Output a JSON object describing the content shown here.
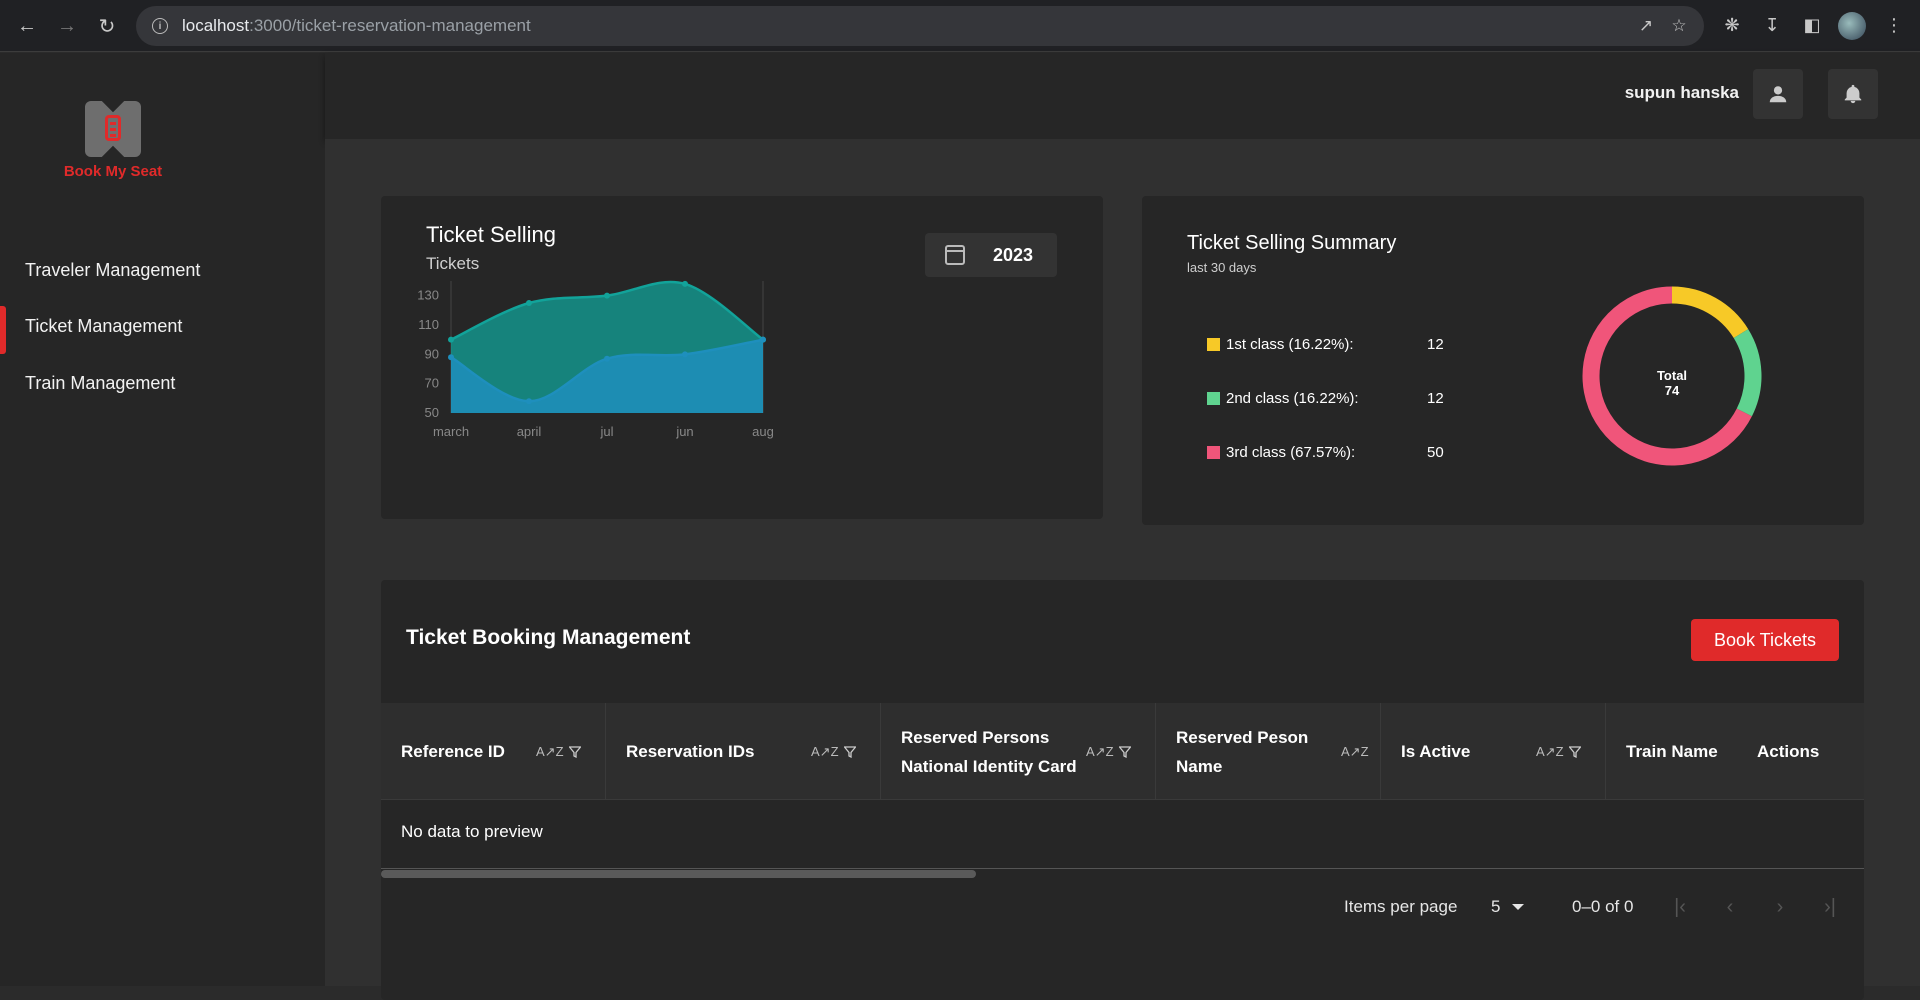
{
  "browser": {
    "url_host": "localhost",
    "url_path": ":3000/ticket-reservation-management"
  },
  "app": {
    "logo_text": "Book My Seat",
    "brand_color": "#e02a2a"
  },
  "sidebar": {
    "items": [
      {
        "label": "Traveler Management",
        "active": false
      },
      {
        "label": "Ticket Management",
        "active": true
      },
      {
        "label": "Train Management",
        "active": false
      }
    ]
  },
  "header": {
    "username": "supun hanska"
  },
  "selling_chart": {
    "title": "Ticket Selling",
    "subtitle": "Tickets",
    "year": "2023"
  },
  "summary": {
    "title": "Ticket Selling Summary",
    "subtitle": "last 30 days",
    "legend": [
      {
        "label": "1st class (16.22%):",
        "value": "12",
        "color": "#f7c927"
      },
      {
        "label": "2nd class (16.22%):",
        "value": "12",
        "color": "#5fd38f"
      },
      {
        "label": "3rd class (67.57%):",
        "value": "50",
        "color": "#f0557a"
      }
    ],
    "center_label": "Total",
    "center_value": "74"
  },
  "booking": {
    "title": "Ticket Booking Management",
    "book_button": "Book Tickets",
    "columns": [
      "Reference ID",
      "Reservation IDs",
      "Reserved Persons National Identity Card",
      "Reserved Peson Name",
      "Is Active",
      "Train Name",
      "Actions"
    ],
    "empty_message": "No data to preview",
    "items_per_page_label": "Items per page",
    "items_per_page": "5",
    "range": "0–0 of 0"
  },
  "chart_data": [
    {
      "type": "area",
      "categories": [
        "march",
        "april",
        "jul",
        "jun",
        "aug"
      ],
      "series": [
        {
          "values": [
            100,
            125,
            130,
            138,
            100
          ],
          "color": "#12a39a"
        },
        {
          "values": [
            88,
            58,
            87,
            90,
            100
          ],
          "color": "#1e8fbd"
        }
      ],
      "yticks": [
        50,
        70,
        90,
        110,
        130
      ],
      "ylim": [
        50,
        140
      ]
    },
    {
      "type": "pie",
      "categories": [
        "1st class",
        "2nd class",
        "3rd class"
      ],
      "values": [
        12,
        12,
        50
      ],
      "colors": [
        "#f7c927",
        "#5fd38f",
        "#f0557a"
      ]
    }
  ]
}
